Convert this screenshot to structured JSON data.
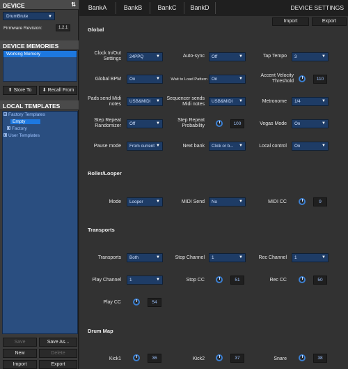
{
  "left": {
    "device_title": "DEVICE",
    "device_select": "DrumBrute",
    "firmware_label": "Firmware Revision:",
    "firmware_value": "1.2.1",
    "memories_title": "DEVICE MEMORIES",
    "memories_items": [
      "Working Memory"
    ],
    "store_to_label": "Store To",
    "recall_from_label": "Recall From",
    "local_templates_title": "LOCAL TEMPLATES",
    "tree": {
      "factory": "Factory Templates",
      "empty": "Empty",
      "factory_sub": "Factory",
      "user": "User Templates"
    },
    "buttons": {
      "save": "Save",
      "save_as": "Save As...",
      "new": "New",
      "delete": "Delete",
      "import": "Import",
      "export": "Export"
    }
  },
  "tabs": [
    "BankA",
    "BankB",
    "BankC",
    "BankD"
  ],
  "device_settings_title": "DEVICE SETTINGS",
  "top_buttons": {
    "import": "Import",
    "export": "Export"
  },
  "sections": {
    "global": "Global",
    "roller": "Roller/Looper",
    "transports": "Transports",
    "drum_map": "Drum Map"
  },
  "global": {
    "clock_label": "Clock In/Out Settings",
    "clock_value": "24PPQ",
    "autosync_label": "Auto-sync",
    "autosync_value": "Off",
    "taptempo_label": "Tap Tempo",
    "taptempo_value": "3",
    "bpm_label": "Global BPM",
    "bpm_value": "On",
    "wait_label": "Wait to Load Pattern",
    "wait_value": "On",
    "accent_label": "Accent Velocity Threshold",
    "accent_value": "110",
    "pads_label": "Pads send Midi notes",
    "pads_value": "USB&MIDI",
    "seq_label": "Sequencer sends Midi notes",
    "seq_value": "USB&MIDI",
    "metronome_label": "Metronome",
    "metronome_value": "1/4",
    "srr_label": "Step Repeat Randomizer",
    "srr_value": "Off",
    "srp_label": "Step Repeat Probability",
    "srp_value": "100",
    "vegas_label": "Vegas Mode",
    "vegas_value": "On",
    "pause_label": "Pause mode",
    "pause_value": "From current",
    "nextbank_label": "Next bank",
    "nextbank_value": "Click or b...",
    "local_label": "Local control",
    "local_value": "On"
  },
  "roller": {
    "mode_label": "Mode",
    "mode_value": "Looper",
    "midisend_label": "MIDI Send",
    "midisend_value": "No",
    "midicc_label": "MIDI CC",
    "midicc_value": "9"
  },
  "transports": {
    "transports_label": "Transports",
    "transports_value": "Both",
    "stopch_label": "Stop Channel",
    "stopch_value": "1",
    "recch_label": "Rec Channel",
    "recch_value": "1",
    "playch_label": "Play Channel",
    "playch_value": "1",
    "stopcc_label": "Stop CC",
    "stopcc_value": "51",
    "reccc_label": "Rec CC",
    "reccc_value": "50",
    "playcc_label": "Play CC",
    "playcc_value": "54"
  },
  "drum_map": {
    "kick1_label": "Kick1",
    "kick1_value": "36",
    "kick2_label": "Kick2",
    "kick2_value": "37",
    "snare_label": "Snare",
    "snare_value": "38"
  }
}
